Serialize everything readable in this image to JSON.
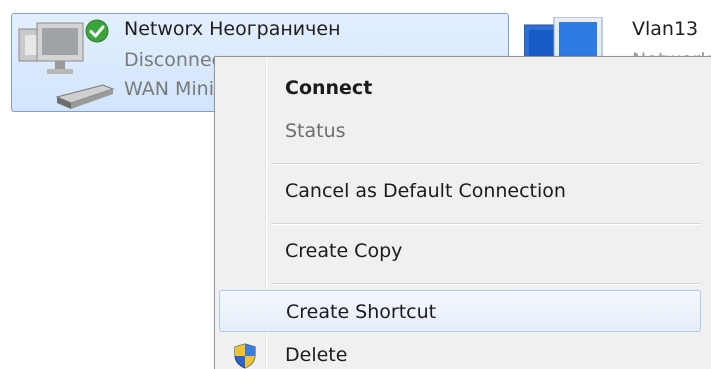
{
  "connections": [
    {
      "name": "Networx Неограничен",
      "status": "Disconnected",
      "device": "WAN Miniport",
      "icon": "network-connection-icon",
      "badge_icon": "green-check-default-icon",
      "selected": true
    },
    {
      "name": "Vlan13",
      "status": "Network",
      "icon": "network-connection-icon",
      "selected": false
    }
  ],
  "context_menu": {
    "items": [
      {
        "label": "Connect",
        "bold": true,
        "disabled": false
      },
      {
        "label": "Status",
        "bold": false,
        "disabled": true
      },
      {
        "label": "Cancel as Default Connection",
        "bold": false,
        "disabled": false
      },
      {
        "label": "Create Copy",
        "bold": false,
        "disabled": false
      },
      {
        "label": "Create Shortcut",
        "bold": false,
        "disabled": false,
        "hover": true
      },
      {
        "label": "Delete",
        "bold": false,
        "disabled": false,
        "icon": "uac-shield-icon"
      }
    ]
  },
  "colors": {
    "selection_fill": "#d2e5fb",
    "selection_border": "#7da2ce",
    "menu_background": "#f0f0f0",
    "hover_border": "#aecbf0",
    "check_green": "#3aa63a"
  }
}
